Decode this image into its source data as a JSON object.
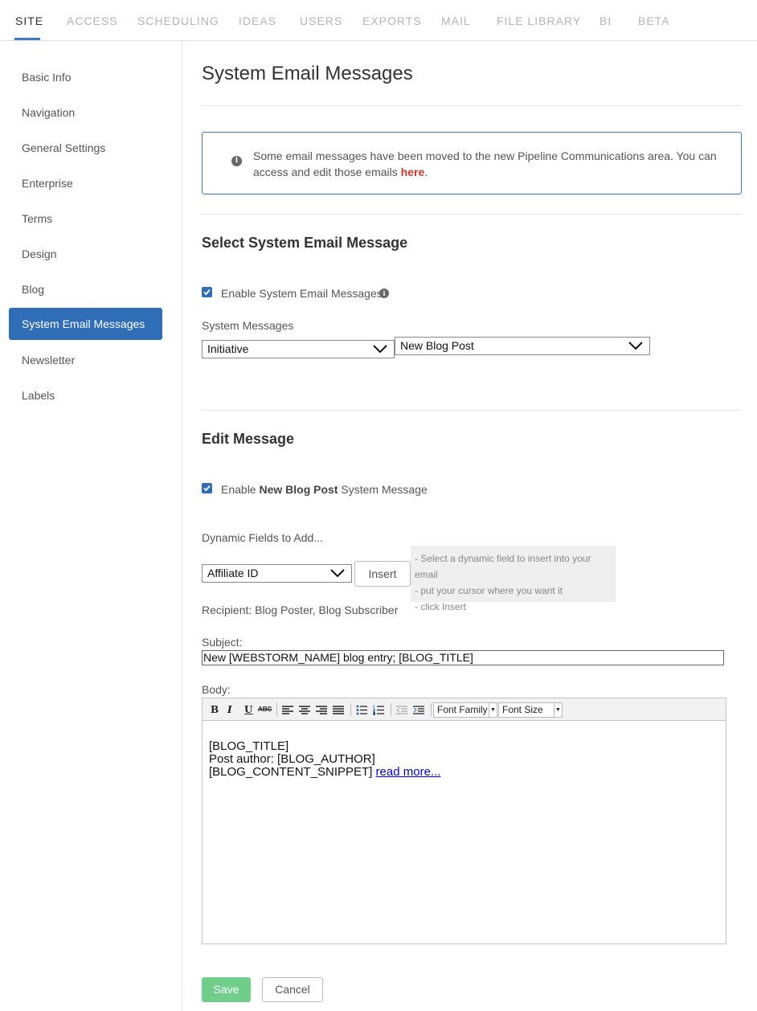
{
  "tabs": [
    "SITE",
    "ACCESS",
    "SCHEDULING",
    "IDEAS",
    "USERS",
    "EXPORTS",
    "MAIL",
    "FILE LIBRARY",
    "BI",
    "BETA"
  ],
  "sidebar": {
    "items": [
      "Basic Info",
      "Navigation",
      "General Settings",
      "Enterprise",
      "Terms",
      "Design",
      "Blog",
      "System Email Messages",
      "Newsletter",
      "Labels"
    ],
    "active": "System Email Messages"
  },
  "page_title": "System Email Messages",
  "notice": {
    "text": "Some email messages have been moved to the new Pipeline Communications area. You can access and edit those emails ",
    "link": "here",
    "end": "."
  },
  "select_section": {
    "title": "Select System Email Message",
    "enable_label": "Enable System Email Messages",
    "enabled": true,
    "messages_label": "System Messages",
    "category_value": "Initiative",
    "message_value": "New Blog Post"
  },
  "edit_section": {
    "title": "Edit Message",
    "enable_prefix": "Enable ",
    "enable_bold": "New Blog Post",
    "enable_suffix": " System Message",
    "enabled": true,
    "dynamic_label": "Dynamic Fields to Add...",
    "dynamic_value": "Affiliate ID",
    "insert_label": "Insert",
    "hint_lines": [
      "- Select a dynamic field to insert into your email",
      "- put your cursor where you want it",
      "- click Insert"
    ],
    "recipient": "Recipient: Blog Poster, Blog Subscriber",
    "subject_label": "Subject:",
    "subject_value": "New [WEBSTORM_NAME] blog entry; [BLOG_TITLE]",
    "body_label": "Body:",
    "toolbar": {
      "bold": "B",
      "italic": "I",
      "underline": "U",
      "strike": "ABC",
      "font_family": "Font Family",
      "font_size": "Font Size"
    },
    "body_lines": [
      "[BLOG_TITLE]",
      "Post author: [BLOG_AUTHOR]",
      "[BLOG_CONTENT_SNIPPET] "
    ],
    "body_link": "read more..."
  },
  "buttons": {
    "save": "Save",
    "cancel": "Cancel"
  },
  "colors": {
    "accent": "#2f6db7",
    "save": "#6fcf8a",
    "link": "#d8342a"
  }
}
